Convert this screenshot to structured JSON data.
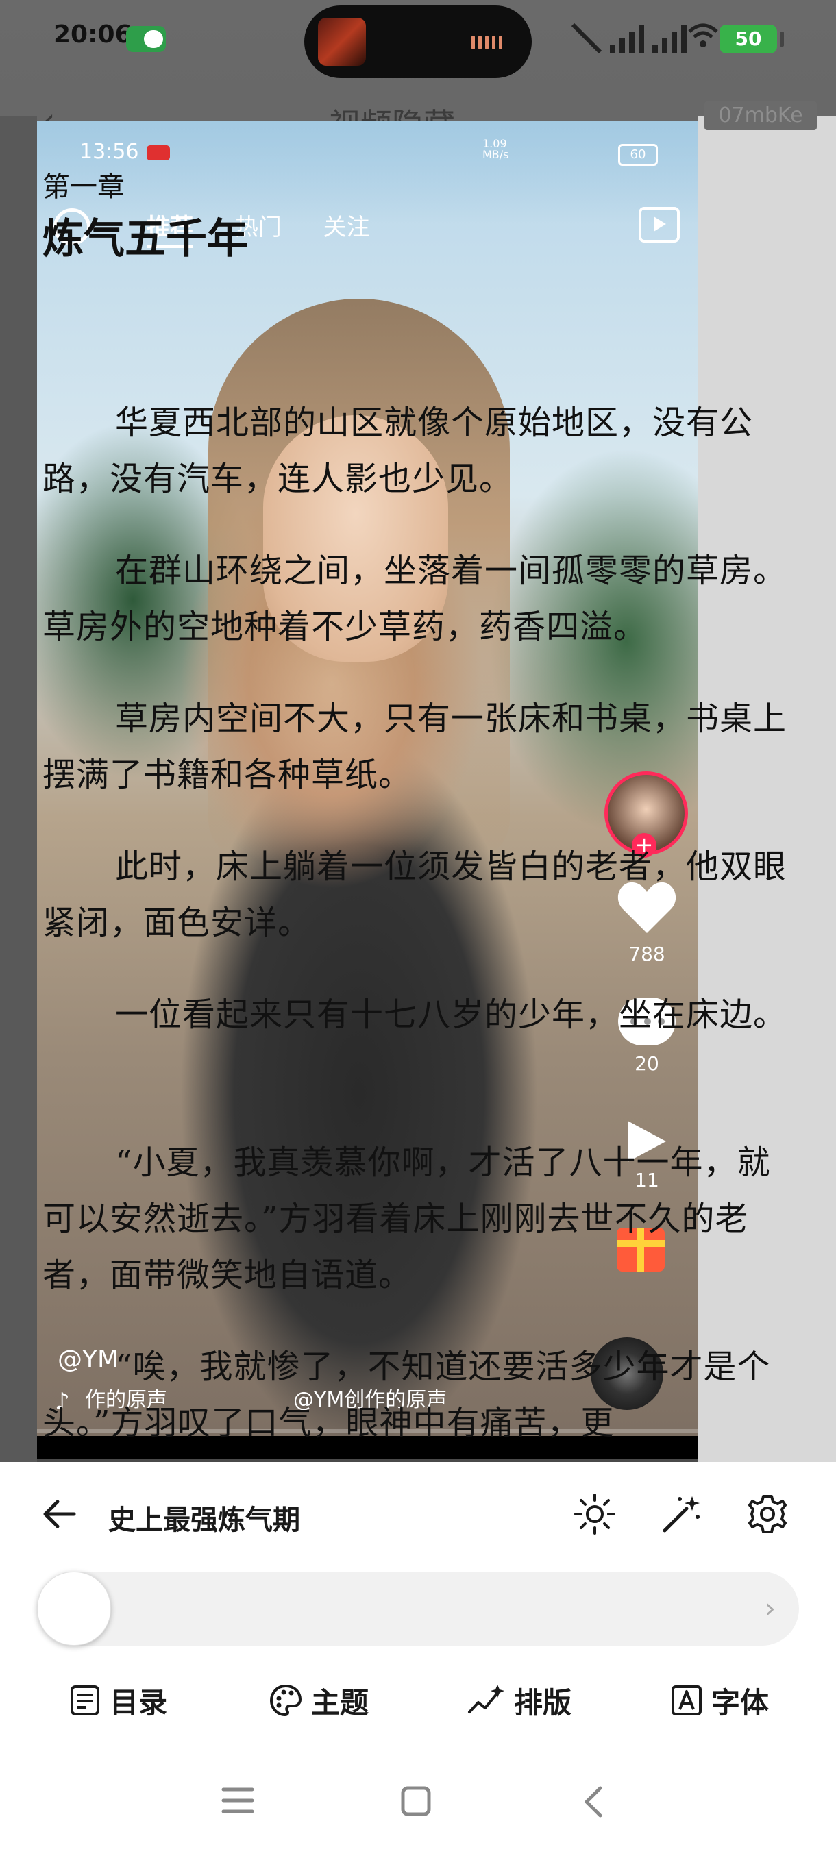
{
  "status_bar": {
    "time": "20:06",
    "battery": "50"
  },
  "background_app": {
    "title": "视频隐藏",
    "badge": "07mbKe"
  },
  "video": {
    "status_time": "13:56",
    "net_speed": "1.09\nMB/s",
    "battery": "60",
    "tabs": [
      "推荐",
      "热门",
      "关注"
    ],
    "likes": "788",
    "comments": "20",
    "shares": "11",
    "author": "@YM",
    "sound_left": "作的原声",
    "sound_center": "@YM创作的原声"
  },
  "reader": {
    "chapter_no": "第一章",
    "chapter_title": "炼气五千年",
    "paragraphs": [
      "华夏西北部的山区就像个原始地区，没有公路，没有汽车，连人影也少见。",
      "在群山环绕之间，坐落着一间孤零零的草房。草房外的空地种着不少草药，药香四溢。",
      "草房内空间不大，只有一张床和书桌，书桌上摆满了书籍和各种草纸。",
      "此时，床上躺着一位须发皆白的老者，他双眼紧闭，面色安详。",
      "一位看起来只有十七八岁的少年，坐在床边。",
      "“小夏，我真羡慕你啊，才活了八十一年，就可以安然逝去。”方羽看着床上刚刚去世不久的老者，面带微笑地自语道。",
      "“唉，我就惨了，不知道还要活多少年才是个头。”方羽叹了口气，眼神中有痛苦，更"
    ]
  },
  "panel": {
    "book_title": "史上最强炼气期",
    "menu": [
      "目录",
      "主题",
      "排版",
      "字体"
    ],
    "progress": 0
  }
}
